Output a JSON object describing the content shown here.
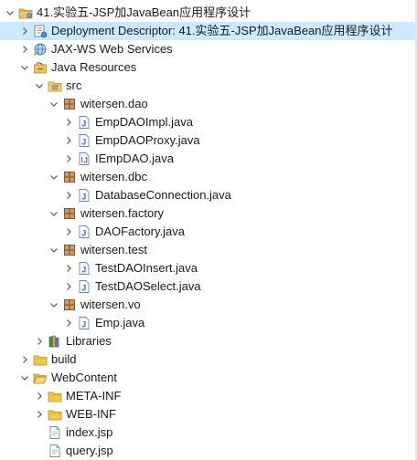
{
  "tree": [
    {
      "label": "41.实验五-JSP加JavaBean应用程序设计",
      "icon": "project-icon",
      "arrow": "down",
      "depth": 0,
      "name": "tree-item-project"
    },
    {
      "label": "Deployment Descriptor: 41.实验五-JSP加JavaBean应用程序设计",
      "icon": "deployment-descriptor-icon",
      "arrow": "right",
      "depth": 1,
      "name": "tree-item-deployment-descriptor",
      "selected": true
    },
    {
      "label": "JAX-WS Web Services",
      "icon": "web-services-icon",
      "arrow": "right",
      "depth": 1,
      "name": "tree-item-jaxws"
    },
    {
      "label": "Java Resources",
      "icon": "java-resources-icon",
      "arrow": "down",
      "depth": 1,
      "name": "tree-item-java-resources"
    },
    {
      "label": "src",
      "icon": "source-folder-icon",
      "arrow": "down",
      "depth": 2,
      "name": "tree-item-src"
    },
    {
      "label": "witersen.dao",
      "icon": "package-icon",
      "arrow": "down",
      "depth": 3,
      "name": "tree-item-package-dao"
    },
    {
      "label": "EmpDAOImpl.java",
      "icon": "java-file-icon",
      "arrow": "right",
      "depth": 4,
      "name": "tree-item-empdaoimpl"
    },
    {
      "label": "EmpDAOProxy.java",
      "icon": "java-file-icon",
      "arrow": "right",
      "depth": 4,
      "name": "tree-item-empdaoproxy"
    },
    {
      "label": "IEmpDAO.java",
      "icon": "java-interface-file-icon",
      "arrow": "right",
      "depth": 4,
      "name": "tree-item-iempdao"
    },
    {
      "label": "witersen.dbc",
      "icon": "package-icon",
      "arrow": "down",
      "depth": 3,
      "name": "tree-item-package-dbc"
    },
    {
      "label": "DatabaseConnection.java",
      "icon": "java-file-icon",
      "arrow": "right",
      "depth": 4,
      "name": "tree-item-databaseconnection"
    },
    {
      "label": "witersen.factory",
      "icon": "package-icon",
      "arrow": "down",
      "depth": 3,
      "name": "tree-item-package-factory"
    },
    {
      "label": "DAOFactory.java",
      "icon": "java-file-icon",
      "arrow": "right",
      "depth": 4,
      "name": "tree-item-daofactory"
    },
    {
      "label": "witersen.test",
      "icon": "package-icon",
      "arrow": "down",
      "depth": 3,
      "name": "tree-item-package-test"
    },
    {
      "label": "TestDAOInsert.java",
      "icon": "java-file-icon",
      "arrow": "right",
      "depth": 4,
      "name": "tree-item-testdaoinsert"
    },
    {
      "label": "TestDAOSelect.java",
      "icon": "java-file-icon",
      "arrow": "right",
      "depth": 4,
      "name": "tree-item-testdaoselect"
    },
    {
      "label": "witersen.vo",
      "icon": "package-icon",
      "arrow": "down",
      "depth": 3,
      "name": "tree-item-package-vo"
    },
    {
      "label": "Emp.java",
      "icon": "java-file-icon",
      "arrow": "right",
      "depth": 4,
      "name": "tree-item-emp"
    },
    {
      "label": "Libraries",
      "icon": "libraries-icon",
      "arrow": "right",
      "depth": 2,
      "name": "tree-item-libraries"
    },
    {
      "label": "build",
      "icon": "folder-icon",
      "arrow": "right",
      "depth": 1,
      "name": "tree-item-build"
    },
    {
      "label": "WebContent",
      "icon": "open-folder-icon",
      "arrow": "down",
      "depth": 1,
      "name": "tree-item-webcontent"
    },
    {
      "label": "META-INF",
      "icon": "folder-icon",
      "arrow": "right",
      "depth": 2,
      "name": "tree-item-meta-inf"
    },
    {
      "label": "WEB-INF",
      "icon": "folder-icon",
      "arrow": "right",
      "depth": 2,
      "name": "tree-item-web-inf"
    },
    {
      "label": "index.jsp",
      "icon": "jsp-file-icon",
      "arrow": "none",
      "depth": 2,
      "name": "tree-item-index-jsp"
    },
    {
      "label": "query.jsp",
      "icon": "jsp-file-icon",
      "arrow": "none",
      "depth": 2,
      "name": "tree-item-query-jsp"
    }
  ],
  "colors": {
    "selection": "#cde8ff",
    "package": "#a0724a",
    "folder": "#e8c46a",
    "java": "#3f6fb5"
  }
}
